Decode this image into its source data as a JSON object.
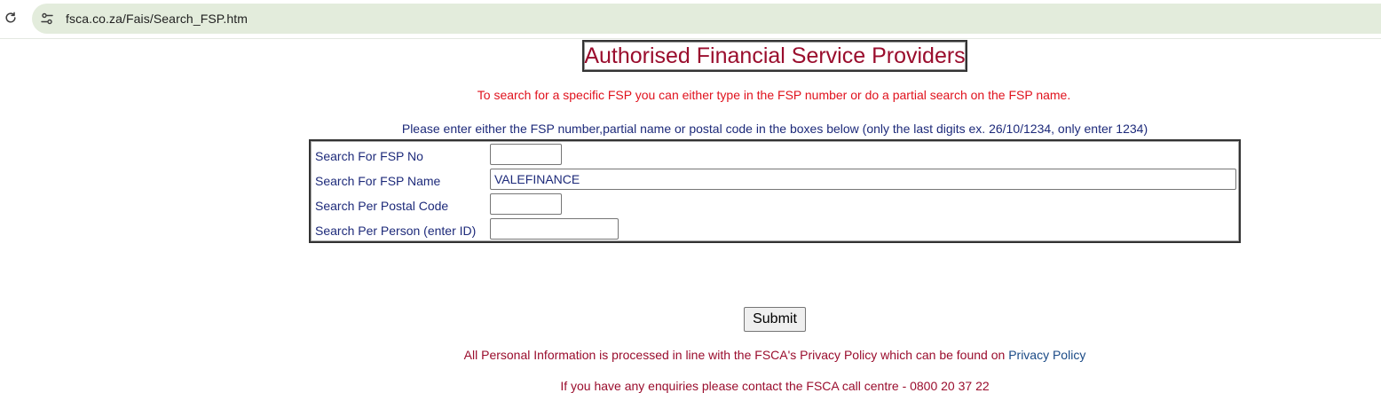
{
  "browser": {
    "url": "fsca.co.za/Fais/Search_FSP.htm",
    "reload_icon": "reload-icon",
    "site_info_icon": "tune-icon"
  },
  "page": {
    "title": "Authorised Financial Service Providers",
    "intro": "To search for a specific FSP you can either type in the FSP number or do a partial search on the FSP name.",
    "instructions": "Please enter either the FSP number,partial name or postal code in the boxes below (only the last digits ex. 26/10/1234, only enter 1234)"
  },
  "search_form": {
    "fsp_no": {
      "label": "Search For FSP No",
      "value": ""
    },
    "fsp_name": {
      "label": "Search For FSP Name",
      "value": "VALEFINANCE"
    },
    "postal_code": {
      "label": "Search Per Postal Code",
      "value": ""
    },
    "person_id": {
      "label": "Search Per Person (enter ID)",
      "value": ""
    },
    "submit_label": "Submit"
  },
  "footer": {
    "privacy_text": "All Personal Information is processed in line with the FSCA's Privacy Policy which can be found on ",
    "privacy_link": "Privacy Policy",
    "enquiries": "If you have any enquiries please contact the FSCA call centre - 0800 20 37 22"
  },
  "colors": {
    "title": "#9a0d2d",
    "intro": "#e0121d",
    "instructions": "#1d2a7a",
    "link": "#1a4a86",
    "address_bar": "#e3ecdc"
  }
}
